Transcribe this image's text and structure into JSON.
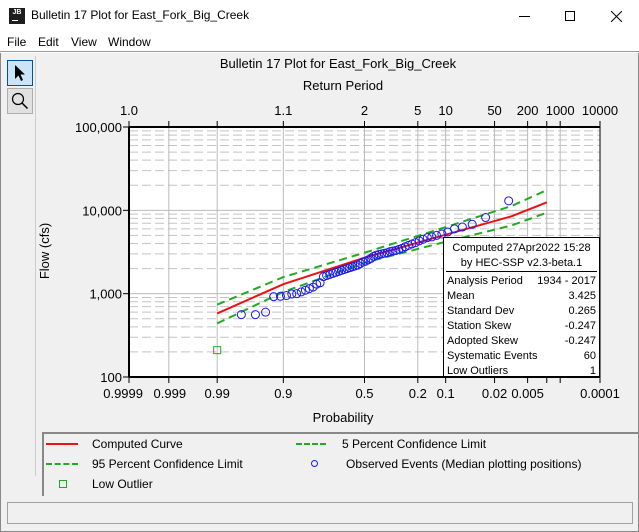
{
  "window": {
    "title": "Bulletin 17 Plot for East_Fork_Big_Creek",
    "icon_label": "JB",
    "controls": [
      "minimize",
      "maximize",
      "close"
    ]
  },
  "menu": [
    "File",
    "Edit",
    "View",
    "Window"
  ],
  "toolbar": {
    "tools": [
      {
        "name": "pointer-tool",
        "icon": "arrow-cursor-icon",
        "active": true
      },
      {
        "name": "zoom-tool",
        "icon": "magnifier-icon",
        "active": false
      }
    ]
  },
  "stats_box": {
    "header_line1": "Computed 27Apr2022 15:28",
    "header_line2": "by HEC-SSP v2.3-beta.1",
    "rows": [
      {
        "label": "Analysis Period",
        "value": "1934 - 2017"
      },
      {
        "label": "Mean",
        "value": "3.425"
      },
      {
        "label": "Standard Dev",
        "value": "0.265"
      },
      {
        "label": "Station Skew",
        "value": "-0.247"
      },
      {
        "label": "Adopted Skew",
        "value": "-0.247"
      },
      {
        "label": "Systematic Events",
        "value": "60"
      },
      {
        "label": "Low Outliers",
        "value": "1"
      }
    ]
  },
  "legend": [
    {
      "label": "Computed Curve",
      "style": "solid",
      "color": "#ee1111"
    },
    {
      "label": "5 Percent Confidence Limit",
      "style": "dashed",
      "color": "#22aa22"
    },
    {
      "label": "95 Percent Confidence Limit",
      "style": "dashed",
      "color": "#22aa22"
    },
    {
      "label": "Observed Events (Median plotting positions)",
      "style": "circle",
      "color": "#1a1aee"
    },
    {
      "label": "Low Outlier",
      "style": "square",
      "color": "#22aa22"
    }
  ],
  "chart_data": {
    "type": "scatter",
    "title": "Bulletin 17 Plot for East_Fork_Big_Creek",
    "top_axis_label": "Return Period",
    "xlabel": "Probability",
    "ylabel": "Flow (cfs)",
    "x_scale": "normal-probability",
    "y_scale": "log",
    "xlim": [
      0.9999,
      0.0001
    ],
    "ylim": [
      100,
      100000
    ],
    "x_ticks": [
      {
        "p": 0.9999,
        "label": "0.9999"
      },
      {
        "p": 0.999,
        "label": "0.999"
      },
      {
        "p": 0.99,
        "label": "0.99"
      },
      {
        "p": 0.9,
        "label": "0.9"
      },
      {
        "p": 0.5,
        "label": "0.5"
      },
      {
        "p": 0.2,
        "label": "0.2"
      },
      {
        "p": 0.1,
        "label": "0.1"
      },
      {
        "p": 0.02,
        "label": "0.02"
      },
      {
        "p": 0.005,
        "label": "0.005"
      },
      {
        "p": 0.0001,
        "label": "0.0001"
      }
    ],
    "x_minor_ticks": [
      0.002,
      0.001
    ],
    "top_ticks": [
      {
        "p": 0.9999,
        "label": "1.0"
      },
      {
        "p": 0.9,
        "label": "1.1"
      },
      {
        "p": 0.5,
        "label": "2"
      },
      {
        "p": 0.2,
        "label": "5"
      },
      {
        "p": 0.1,
        "label": "10"
      },
      {
        "p": 0.02,
        "label": "50"
      },
      {
        "p": 0.005,
        "label": "200"
      },
      {
        "p": 0.001,
        "label": "1000"
      },
      {
        "p": 0.0001,
        "label": "10000"
      }
    ],
    "top_minor_ticks": [
      0.999,
      0.99,
      0.002
    ],
    "y_ticks": [
      {
        "v": 100000,
        "label": "100,000"
      },
      {
        "v": 10000,
        "label": "10,000"
      },
      {
        "v": 1000,
        "label": "1,000"
      },
      {
        "v": 100,
        "label": "100"
      }
    ],
    "grid": true,
    "series": [
      {
        "name": "Computed Curve",
        "type": "line",
        "p": [
          0.99,
          0.9,
          0.5,
          0.1,
          0.01,
          0.002
        ],
        "values": [
          580,
          1300,
          2700,
          5100,
          8500,
          12500
        ]
      },
      {
        "name": "5 Percent Confidence Limit",
        "type": "line",
        "p": [
          0.99,
          0.9,
          0.5,
          0.1,
          0.01,
          0.002
        ],
        "values": [
          740,
          1580,
          3100,
          6300,
          11300,
          17500
        ]
      },
      {
        "name": "95 Percent Confidence Limit",
        "type": "line",
        "p": [
          0.99,
          0.9,
          0.5,
          0.1,
          0.01,
          0.002
        ],
        "values": [
          440,
          1050,
          2350,
          4200,
          6600,
          9400
        ]
      },
      {
        "name": "Observed Events (Median plotting positions)",
        "type": "scatter",
        "p": [
          0.0114,
          0.0279,
          0.0445,
          0.0611,
          0.0777,
          0.0943,
          0.1109,
          0.1275,
          0.1441,
          0.1607,
          0.1773,
          0.1939,
          0.2105,
          0.2271,
          0.2437,
          0.2603,
          0.2769,
          0.2935,
          0.3101,
          0.3267,
          0.3433,
          0.3599,
          0.3765,
          0.3931,
          0.4097,
          0.4263,
          0.4429,
          0.4595,
          0.4761,
          0.4927,
          0.5093,
          0.5259,
          0.5425,
          0.5591,
          0.5757,
          0.5923,
          0.6089,
          0.6255,
          0.6421,
          0.6587,
          0.6753,
          0.6919,
          0.7085,
          0.7251,
          0.7417,
          0.7583,
          0.7749,
          0.7915,
          0.8081,
          0.8247,
          0.8413,
          0.8579,
          0.8745,
          0.8911,
          0.9077,
          0.9243,
          0.9409,
          0.9575,
          0.9741
        ],
        "values": [
          13000,
          8200,
          6800,
          6300,
          6000,
          5500,
          5200,
          5000,
          4800,
          4700,
          4500,
          4300,
          4100,
          3950,
          3800,
          3650,
          3500,
          3400,
          3300,
          3250,
          3200,
          3100,
          3050,
          3000,
          2950,
          2900,
          2800,
          2650,
          2550,
          2450,
          2400,
          2300,
          2200,
          2150,
          2100,
          2050,
          2000,
          1950,
          1900,
          1850,
          1800,
          1750,
          1700,
          1650,
          1600,
          1350,
          1300,
          1200,
          1150,
          1100,
          1050,
          1000,
          990,
          950,
          930,
          920,
          600,
          560,
          560
        ]
      },
      {
        "name": "Low Outlier",
        "type": "scatter",
        "p": [
          0.99
        ],
        "values": [
          210
        ]
      }
    ]
  }
}
